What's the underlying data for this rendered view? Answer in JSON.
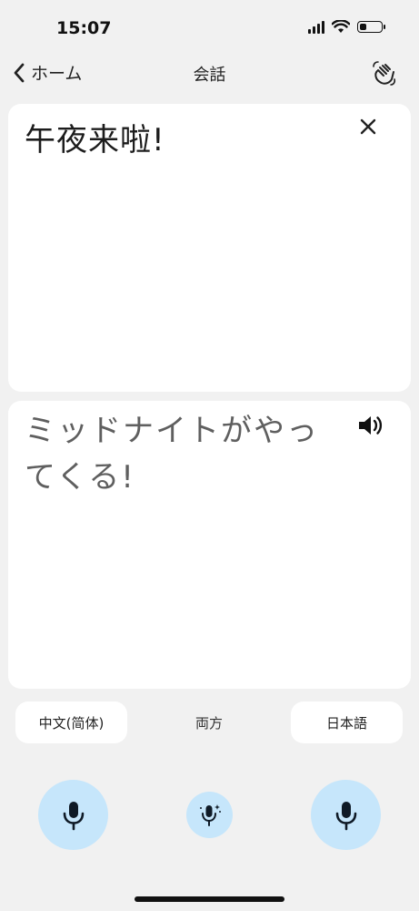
{
  "status": {
    "time": "15:07",
    "battery_level": 0.3
  },
  "nav": {
    "back_label": "ホーム",
    "title": "会話"
  },
  "source": {
    "text": "午夜来啦!"
  },
  "target": {
    "text": "ミッドナイトがやってくる!"
  },
  "languages": {
    "left": "中文(简体)",
    "both": "両方",
    "right": "日本語"
  },
  "colors": {
    "mic_bg": "#c6e6fb",
    "card_bg": "#ffffff",
    "page_bg": "#f1f1f1"
  },
  "icons": {
    "back": "chevron-left-icon",
    "wave": "waving-hand-icon",
    "close": "close-icon",
    "speaker": "speaker-icon",
    "mic": "microphone-icon",
    "auto_mic": "sparkle-microphone-icon"
  }
}
